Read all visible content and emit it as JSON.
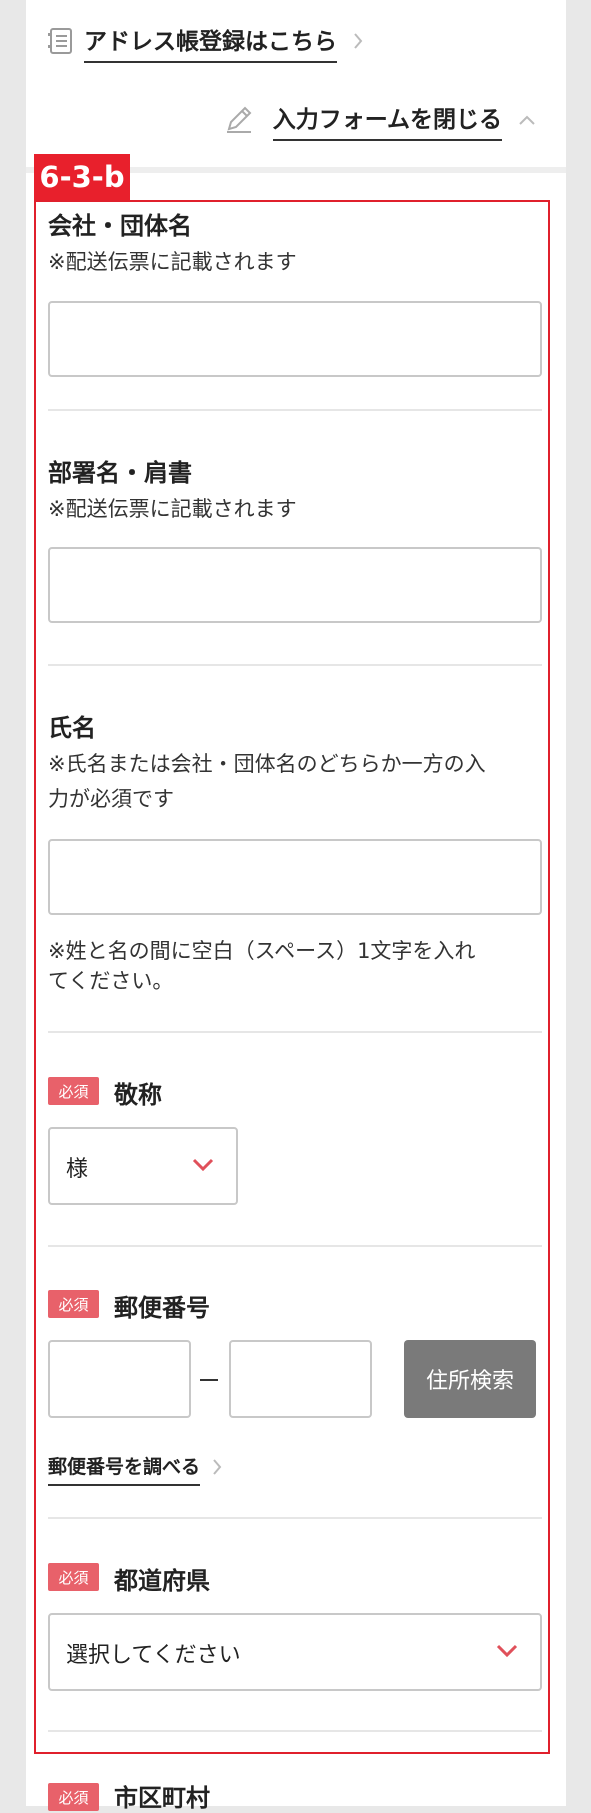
{
  "header": {
    "address_link": "アドレス帳登録はこちら",
    "close_form": "入力フォームを閉じる"
  },
  "section_tag": "6-3-b",
  "required_badge": "必須",
  "fields": {
    "company": {
      "label": "会社・団体名",
      "note": "※配送伝票に記載されます",
      "value": ""
    },
    "department": {
      "label": "部署名・肩書",
      "note": "※配送伝票に記載されます",
      "value": ""
    },
    "name": {
      "label": "氏名",
      "note_line1": "※氏名または会社・団体名のどちらか一方の入",
      "note_line2": "力が必須です",
      "value": "",
      "hint_line1": "※姓と名の間に空白（スペース）1文字を入れ",
      "hint_line2": "てください。"
    },
    "honorific": {
      "label": "敬称",
      "selected": "様"
    },
    "postal": {
      "label": "郵便番号",
      "search_button": "住所検索",
      "lookup_link": "郵便番号を調べる"
    },
    "prefecture": {
      "label": "都道府県",
      "selected": "選択してください"
    },
    "city": {
      "label": "市区町村"
    }
  },
  "colors": {
    "accent_red": "#e8202c",
    "badge_red": "#e8616a",
    "button_gray": "#7a7a7a"
  }
}
